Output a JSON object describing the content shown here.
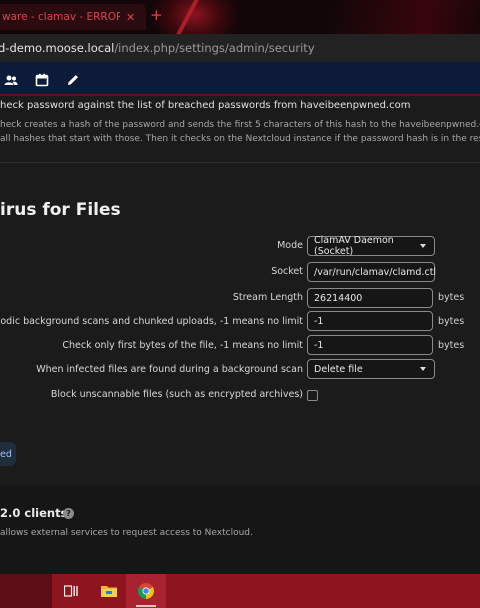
{
  "browser": {
    "tab_title": "ware - clamav - ERROR: /va",
    "tab_close": "✕",
    "new_tab": "+",
    "url_host": "d-demo.moose.local",
    "url_path": "/index.php/settings/admin/security"
  },
  "header": {
    "icons": [
      "contacts-icon",
      "calendar-icon",
      "edit-icon"
    ]
  },
  "password_policy": {
    "check_label": "heck password against the list of breached passwords from haveibeenpwned.com",
    "description_line1": "heck creates a hash of the password and sends the first 5 characters of this hash to the haveibeenpwned.com API to retri",
    "description_line2": " all hashes that start with those. Then it checks on the Nextcloud instance if the password hash is in the result set."
  },
  "antivirus": {
    "title": "irus for Files",
    "mode_label": "Mode",
    "mode_value": "ClamAV Daemon (Socket)",
    "socket_label": "Socket",
    "socket_value": "/var/run/clamav/clamd.ctl",
    "stream_length_label": "Stream Length",
    "stream_length_value": "26214400",
    "stream_length_unit": "bytes",
    "file_size_limit_label": "imit for periodic background scans and chunked uploads, -1 means no limit",
    "file_size_limit_value": "-1",
    "file_size_limit_unit": "bytes",
    "check_first_bytes_label": "Check only first bytes of the file, -1 means no limit",
    "check_first_bytes_value": "-1",
    "check_first_bytes_unit": "bytes",
    "infected_action_label": "When infected files are found during a background scan",
    "infected_action_value": "Delete file",
    "block_unscannable_label": "Block unscannable files (such as encrypted archives)",
    "save_button": "ed"
  },
  "oauth": {
    "title": "2.0 clients",
    "help": "?",
    "description": " allows external services to request access to Nextcloud."
  },
  "taskbar": {
    "items": [
      "task-view-icon",
      "file-explorer-icon",
      "chrome-icon"
    ]
  }
}
